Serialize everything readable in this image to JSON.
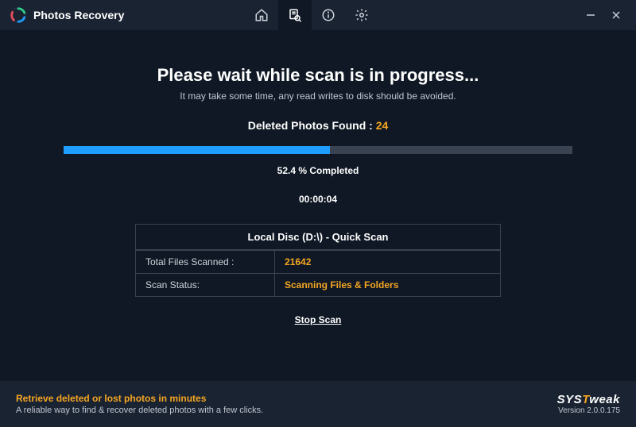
{
  "app": {
    "title": "Photos Recovery"
  },
  "scan": {
    "heading": "Please wait while scan is in progress...",
    "subheading": "It may take some time, any read writes to disk should be avoided.",
    "found_label": "Deleted Photos Found :",
    "found_count": "24",
    "percent_value": 52.4,
    "percent_text": "52.4 % Completed",
    "elapsed": "00:00:04",
    "target_header": "Local Disc (D:\\) - Quick Scan",
    "rows": [
      {
        "label": "Total Files Scanned :",
        "value": "21642"
      },
      {
        "label": "Scan Status:",
        "value": "Scanning Files & Folders"
      }
    ],
    "stop_label": "Stop Scan"
  },
  "footer": {
    "title": "Retrieve deleted or lost photos in minutes",
    "sub": "A reliable way to find & recover deleted photos with a few clicks.",
    "brand_a": "SYS",
    "brand_b": "T",
    "brand_c": "weak",
    "version": "Version 2.0.0.175"
  }
}
